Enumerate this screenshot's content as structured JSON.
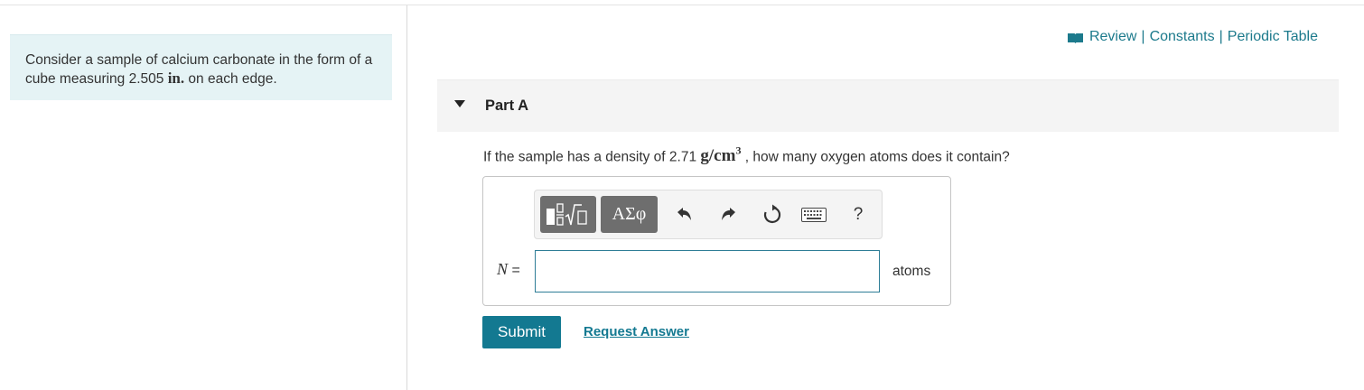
{
  "problem": {
    "text_before": "Consider a sample of calcium carbonate in the form of a cube measuring 2.505 ",
    "unit": "in.",
    "text_after": " on each edge."
  },
  "top_links": {
    "icon": "book-icon",
    "review": "Review",
    "separator": "|",
    "constants": "Constants",
    "periodic_table": "Periodic Table"
  },
  "part": {
    "title": "Part A",
    "expand_icon": "caret-down-icon"
  },
  "question": {
    "text_before": "If the sample has a density of 2.71 ",
    "unit_base": "g/cm",
    "unit_exponent": "3",
    "text_after": " , how many oxygen atoms does it contain?"
  },
  "toolbar": {
    "math_template_icon": "fraction-sqrt-template-icon",
    "greek_label": "ΑΣφ",
    "undo_icon": "undo-icon",
    "redo_icon": "redo-icon",
    "reset_icon": "reset-icon",
    "keyboard_icon": "keyboard-icon",
    "help_label": "?"
  },
  "answer": {
    "variable": "N",
    "equals": "=",
    "value": "",
    "units": "atoms"
  },
  "actions": {
    "submit": "Submit",
    "request_answer": "Request Answer"
  },
  "colors": {
    "accent": "#137991",
    "link": "#1c7a8c",
    "problem_bg": "#e5f3f5"
  }
}
